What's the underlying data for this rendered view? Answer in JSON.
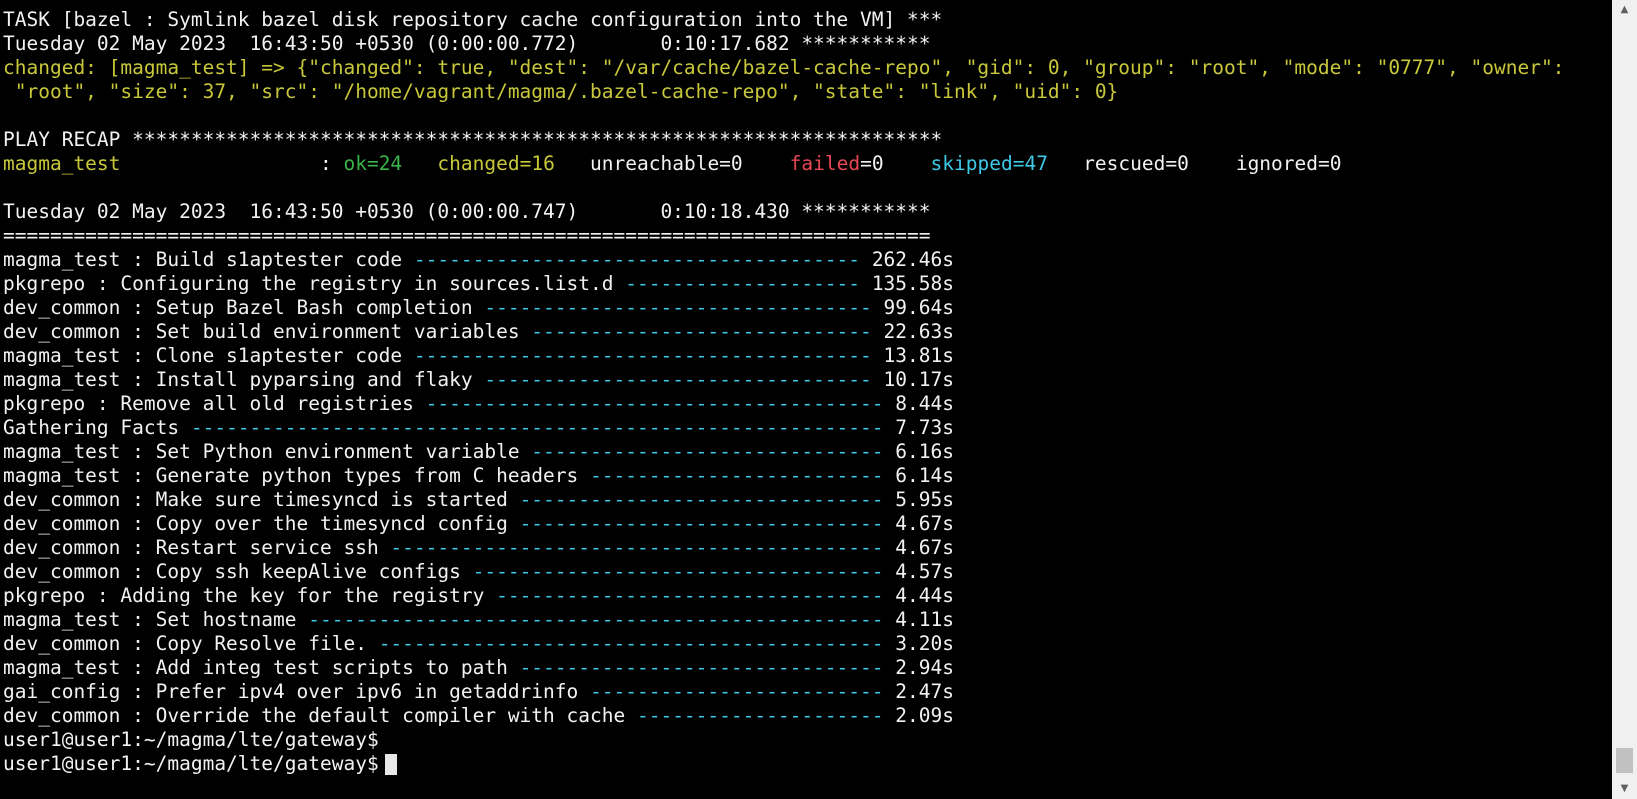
{
  "task_header": "TASK [bazel : Symlink bazel disk repository cache configuration into the VM] ***",
  "task_time": "Tuesday 02 May 2023  16:43:50 +0530 (0:00:00.772)       0:10:17.682 ***********",
  "changed_line_1": "changed: [magma_test] => {\"changed\": true, \"dest\": \"/var/cache/bazel-cache-repo\", \"gid\": 0, \"group\": \"root\", \"mode\": \"0777\", \"owner\":",
  "changed_line_2": " \"root\", \"size\": 37, \"src\": \"/home/vagrant/magma/.bazel-cache-repo\", \"state\": \"link\", \"uid\": 0}",
  "play_recap": "PLAY RECAP *********************************************************************",
  "recap": {
    "host": "magma_test",
    "sep": "                 : ",
    "ok": "ok=24",
    "changed": "changed=16",
    "unreachable": "unreachable=0",
    "failed_label": "failed",
    "failed_value": "=0",
    "skipped": "skipped=47",
    "rescued": "rescued=0",
    "ignored": "ignored=0"
  },
  "summary_time": "Tuesday 02 May 2023  16:43:50 +0530 (0:00:00.747)       0:10:18.430 ***********",
  "divider": "===============================================================================",
  "tasks": [
    {
      "name": "magma_test : Build s1aptester code",
      "duration": "262.46s"
    },
    {
      "name": "pkgrepo : Configuring the registry in sources.list.d",
      "duration": "135.58s"
    },
    {
      "name": "dev_common : Setup Bazel Bash completion",
      "duration": "99.64s"
    },
    {
      "name": "dev_common : Set build environment variables",
      "duration": "22.63s"
    },
    {
      "name": "magma_test : Clone s1aptester code",
      "duration": "13.81s"
    },
    {
      "name": "magma_test : Install pyparsing and flaky",
      "duration": "10.17s"
    },
    {
      "name": "pkgrepo : Remove all old registries",
      "duration": "8.44s"
    },
    {
      "name": "Gathering Facts",
      "duration": "7.73s"
    },
    {
      "name": "magma_test : Set Python environment variable",
      "duration": "6.16s"
    },
    {
      "name": "magma_test : Generate python types from C headers",
      "duration": "6.14s"
    },
    {
      "name": "dev_common : Make sure timesyncd is started",
      "duration": "5.95s"
    },
    {
      "name": "dev_common : Copy over the timesyncd config",
      "duration": "4.67s"
    },
    {
      "name": "dev_common : Restart service ssh",
      "duration": "4.67s"
    },
    {
      "name": "dev_common : Copy ssh keepAlive configs",
      "duration": "4.57s"
    },
    {
      "name": "pkgrepo : Adding the key for the registry",
      "duration": "4.44s"
    },
    {
      "name": "magma_test : Set hostname",
      "duration": "4.11s"
    },
    {
      "name": "dev_common : Copy Resolve file.",
      "duration": "3.20s"
    },
    {
      "name": "magma_test : Add integ test scripts to path",
      "duration": "2.94s"
    },
    {
      "name": "gai_config : Prefer ipv4 over ipv6 in getaddrinfo",
      "duration": "2.47s"
    },
    {
      "name": "dev_common : Override the default compiler with cache",
      "duration": "2.09s"
    }
  ],
  "prompts": [
    "user1@user1:~/magma/lte/gateway$",
    "user1@user1:~/magma/lte/gateway$"
  ],
  "icons": {
    "scroll_up": "scroll-up-arrow-icon",
    "scroll_down": "scroll-down-arrow-icon"
  }
}
